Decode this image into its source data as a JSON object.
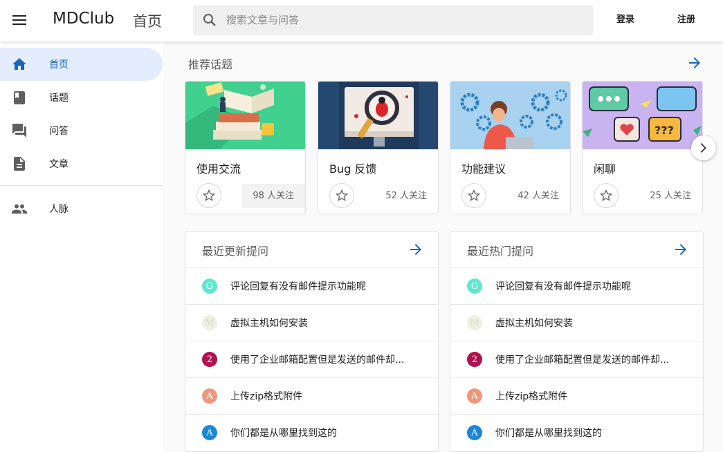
{
  "app": {
    "brand": "MDClub",
    "page_name": "首页"
  },
  "search": {
    "placeholder": "搜索文章与问答"
  },
  "auth": {
    "login": "登录",
    "register": "注册"
  },
  "colors": {
    "accent": "#1565c0",
    "active_bg": "#e3edfd"
  },
  "sidebar": {
    "items": [
      {
        "label": "首页",
        "icon": "home-icon",
        "active": true
      },
      {
        "label": "话题",
        "icon": "book-icon",
        "active": false
      },
      {
        "label": "问答",
        "icon": "forum-icon",
        "active": false
      },
      {
        "label": "文章",
        "icon": "article-icon",
        "active": false
      },
      {
        "label": "人脉",
        "icon": "people-icon",
        "active": false
      }
    ]
  },
  "topics": {
    "title": "推荐话题",
    "items": [
      {
        "name": "使用交流",
        "followers": "98 人关注",
        "image": "books-illustration"
      },
      {
        "name": "Bug 反馈",
        "followers": "52 人关注",
        "image": "bug-magnifier-illustration"
      },
      {
        "name": "功能建议",
        "followers": "42 人关注",
        "image": "gears-illustration"
      },
      {
        "name": "闲聊",
        "followers": "25 人关注",
        "image": "chat-bubbles-illustration"
      }
    ]
  },
  "recent_questions": {
    "title": "最近更新提问",
    "items": [
      {
        "avatar_letter": "G",
        "avatar_color": "#5ee8cf",
        "text": "评论回复有没有邮件提示功能呢"
      },
      {
        "avatar_letter": "M",
        "avatar_color": "#eef0e4",
        "text": "虚拟主机如何安装"
      },
      {
        "avatar_letter": "2",
        "avatar_color": "#b0124f",
        "text": "使用了企业邮箱配置但是发送的邮件却..."
      },
      {
        "avatar_letter": "A",
        "avatar_color": "#f0967a",
        "text": "上传zip格式附件"
      },
      {
        "avatar_letter": "A",
        "avatar_color": "#1a86d8",
        "text": "你们都是从哪里找到这的"
      }
    ]
  },
  "hot_questions": {
    "title": "最近热门提问",
    "items": [
      {
        "avatar_letter": "G",
        "avatar_color": "#5ee8cf",
        "text": "评论回复有没有邮件提示功能呢"
      },
      {
        "avatar_letter": "M",
        "avatar_color": "#eef0e4",
        "text": "虚拟主机如何安装"
      },
      {
        "avatar_letter": "2",
        "avatar_color": "#b0124f",
        "text": "使用了企业邮箱配置但是发送的邮件却..."
      },
      {
        "avatar_letter": "A",
        "avatar_color": "#f0967a",
        "text": "上传zip格式附件"
      },
      {
        "avatar_letter": "A",
        "avatar_color": "#1a86d8",
        "text": "你们都是从哪里找到这的"
      }
    ]
  }
}
